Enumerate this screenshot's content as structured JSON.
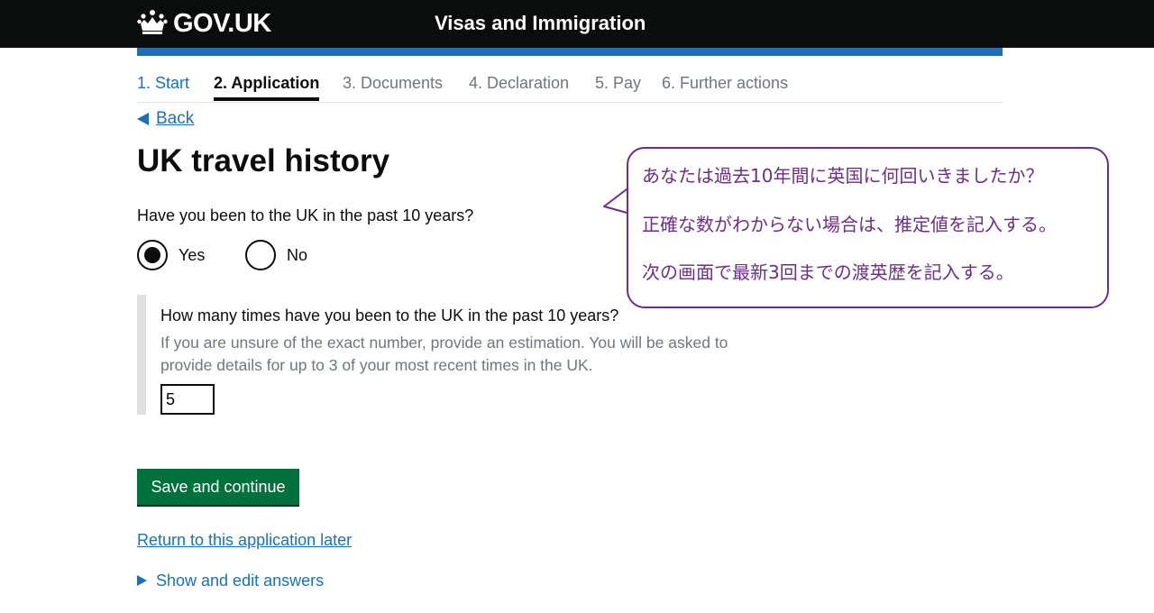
{
  "header": {
    "logo_text": "GOV.UK",
    "service_name": "Visas and Immigration"
  },
  "steps": [
    "1. Start",
    "2. Application",
    "3. Documents",
    "4. Declaration",
    "5. Pay",
    "6. Further actions"
  ],
  "back_label": "Back",
  "page_title": "UK travel history",
  "question": "Have you been to the UK in the past 10 years?",
  "radios": {
    "yes_label": "Yes",
    "no_label": "No",
    "selected": "Yes"
  },
  "followup": {
    "question": "How many times have you been to the UK in the past 10 years?",
    "hint": "If you are unsure of the exact number, provide an estimation. You will be asked to provide details for up to 3 of your most recent times in the UK.",
    "value": "5"
  },
  "save_button": "Save and continue",
  "return_link": "Return to this application later",
  "details_summary": "Show and edit answers",
  "callout": {
    "line1": "あなたは過去10年間に英国に何回いきましたか？",
    "line2": "正確な数がわからない場合は、推定値を記入する。",
    "line3": "次の画面で最新3回までの渡英歴を記入する。"
  },
  "colors": {
    "header_bg": "#0b0c0c",
    "link": "#1d70b8",
    "button": "#00703c",
    "callout_border": "#6b2f87"
  },
  "icons": {
    "logo": "crown-icon"
  }
}
